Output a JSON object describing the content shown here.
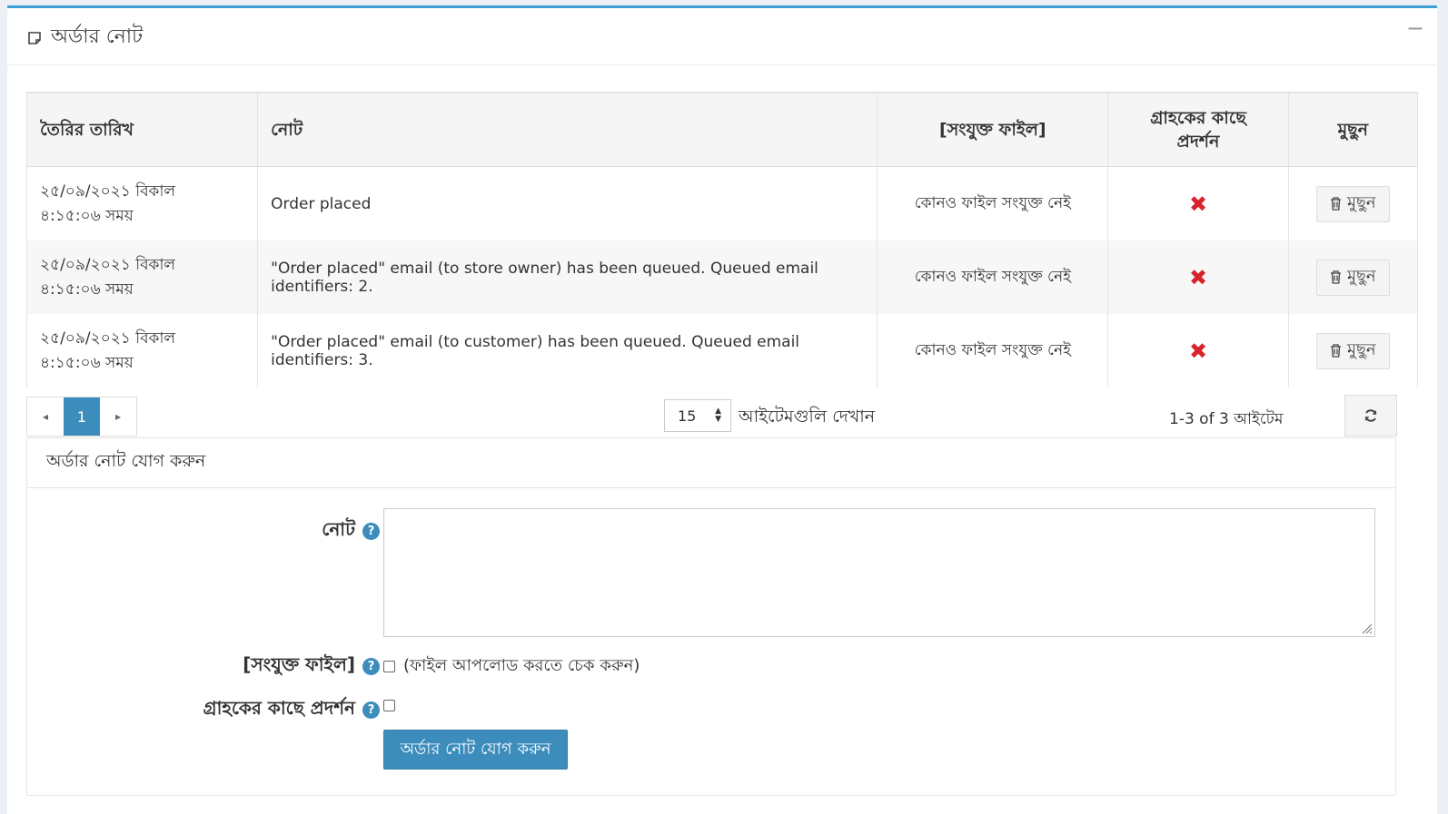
{
  "card": {
    "title": "অর্ডার নোট",
    "collapse_label": "−"
  },
  "table": {
    "headers": {
      "date": "তৈরির তারিখ",
      "note": "নোট",
      "file": "[সংযুক্ত ফাইল]",
      "display_to_customer_line1": "গ্রাহকের কাছে",
      "display_to_customer_line2": "প্রদর্শন",
      "delete": "মুছুন"
    },
    "rows": [
      {
        "date_line1": "২৫/০৯/২০২১ বিকাল",
        "date_line2": "৪:১৫:০৬ সময়",
        "note": "Order placed",
        "file": "কোনও ফাইল সংযুক্ত নেই",
        "display_to_customer": "✖",
        "delete_label": "মুছুন"
      },
      {
        "date_line1": "২৫/০৯/২০২১ বিকাল",
        "date_line2": "৪:১৫:০৬ সময়",
        "note": "\"Order placed\" email (to store owner) has been queued. Queued email identifiers: 2.",
        "file": "কোনও ফাইল সংযুক্ত নেই",
        "display_to_customer": "✖",
        "delete_label": "মুছুন"
      },
      {
        "date_line1": "২৫/০৯/২০২১ বিকাল",
        "date_line2": "৪:১৫:০৬ সময়",
        "note": "\"Order placed\" email (to customer) has been queued. Queued email identifiers: 3.",
        "file": "কোনও ফাইল সংযুক্ত নেই",
        "display_to_customer": "✖",
        "delete_label": "মুছুন"
      }
    ]
  },
  "pager": {
    "prev": "◂",
    "current_page": "1",
    "next": "▸",
    "page_size": "15",
    "page_size_label": "আইটেমগুলি দেখান",
    "range_info": "1-3 of 3 আইটেম"
  },
  "add_note": {
    "heading": "অর্ডার নোট যোগ করুন",
    "note_label": "নোট",
    "file_label": "[সংযুক্ত ফাইল]",
    "file_checkbox_text": "(ফাইল আপলোড করতে চেক করুন)",
    "display_label": "গ্রাহকের কাছে প্রদর্শন",
    "help_glyph": "?",
    "submit_label": "অর্ডার নোট যোগ করুন"
  },
  "colors": {
    "accent": "#3c8dbc",
    "card_top_border": "#3c9fd6",
    "danger": "#d9232d",
    "page_bg": "#ecf0f5"
  }
}
